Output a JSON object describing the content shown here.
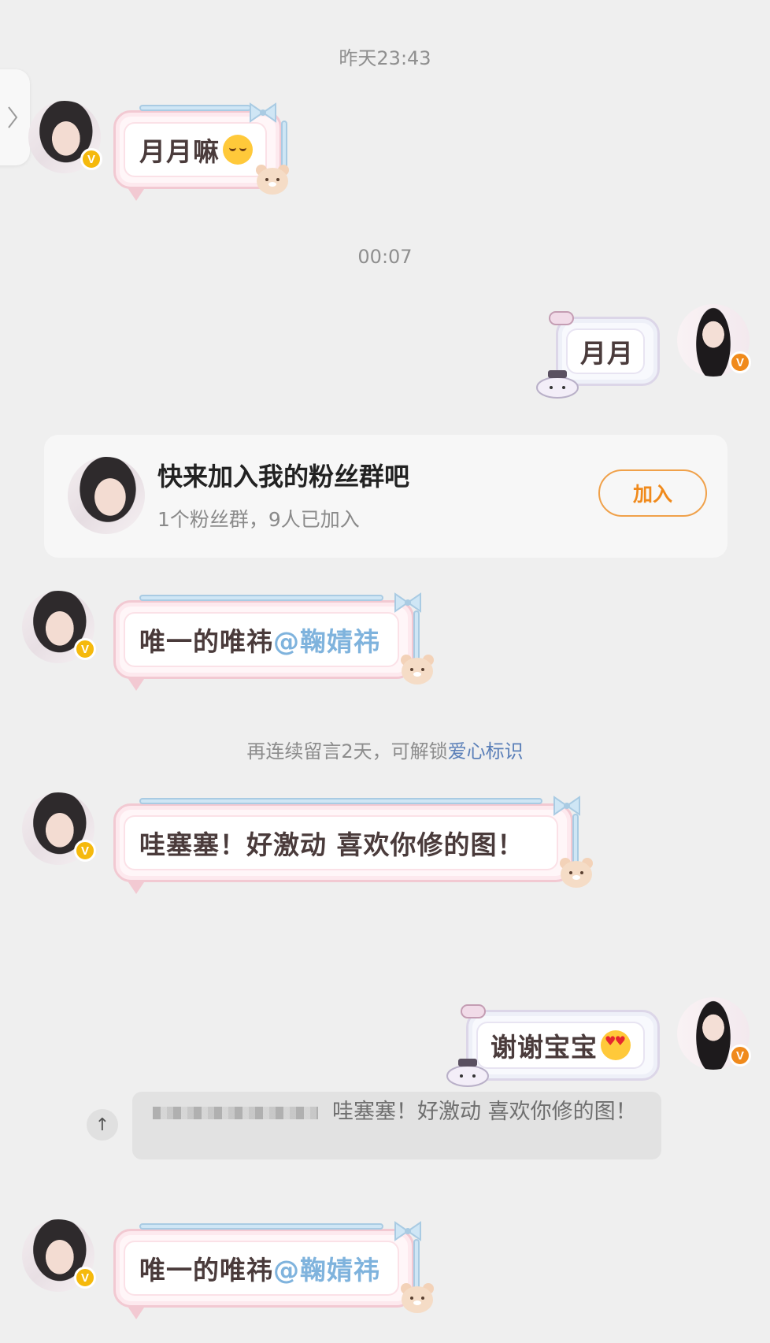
{
  "timestamps": [
    "昨天23:43",
    "00:07"
  ],
  "messages": [
    {
      "text": "月月嘛",
      "emoji": "relieved-face"
    },
    {
      "text": "月月"
    },
    {
      "text": "唯一的唯祎",
      "mention": "@鞠婧祎"
    },
    {
      "text": "哇塞塞！好激动 喜欢你修的图！"
    },
    {
      "text": "谢谢宝宝",
      "emoji": "heart-eyes-face"
    },
    {
      "text": "唯一的唯祎",
      "mention": "@鞠婧祎"
    }
  ],
  "group_card": {
    "title": "快来加入我的粉丝群吧",
    "subtitle": "1个粉丝群，9人已加入",
    "join_label": "加入"
  },
  "notice": {
    "text": "再连续留言2天，可解锁",
    "link": "爱心标识"
  },
  "quote": {
    "text": "哇塞塞！好激动 喜欢你修的图！",
    "icon": "quote-reply-icon"
  },
  "colors": {
    "background": "#efefef",
    "join_accent": "#f08a1c",
    "mention": "#7fb3dd",
    "verified_badge": "#f5b90c"
  }
}
